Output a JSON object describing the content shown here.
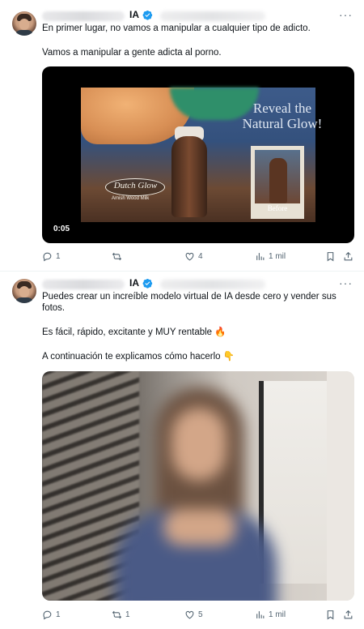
{
  "tweets": [
    {
      "name_suffix": "IA",
      "more": "···",
      "text_lines": [
        "En primer lugar, no vamos a manipular a cualquier tipo de adicto.",
        "Vamos a manipular a gente adicta al porno."
      ],
      "video": {
        "overlay_text": "Reveal the Natural Glow!",
        "logo_text": "Dutch Glow",
        "logo_subtext": "Amish Wood Milk",
        "before_label": "Before",
        "timer": "0:05"
      },
      "actions": {
        "replies": "1",
        "reposts": "",
        "likes": "4",
        "views": "1 mil"
      }
    },
    {
      "name_suffix": "IA",
      "more": "···",
      "text_lines": [
        "Puedes crear un increíble modelo virtual de IA desde cero y vender sus fotos.",
        "Es fácil, rápido, excitante y MUY rentable 🔥",
        "A continuación te explicamos cómo hacerlo 👇"
      ],
      "actions": {
        "replies": "1",
        "reposts": "1",
        "likes": "5",
        "views": "1 mil"
      }
    }
  ],
  "colors": {
    "verified": "#1d9bf0",
    "icon": "#536471",
    "text": "#0f1419",
    "divider": "#eff3f4"
  },
  "icons": [
    "reply-icon",
    "repost-icon",
    "like-icon",
    "views-icon",
    "bookmark-icon",
    "share-icon",
    "verified-icon",
    "more-icon"
  ]
}
